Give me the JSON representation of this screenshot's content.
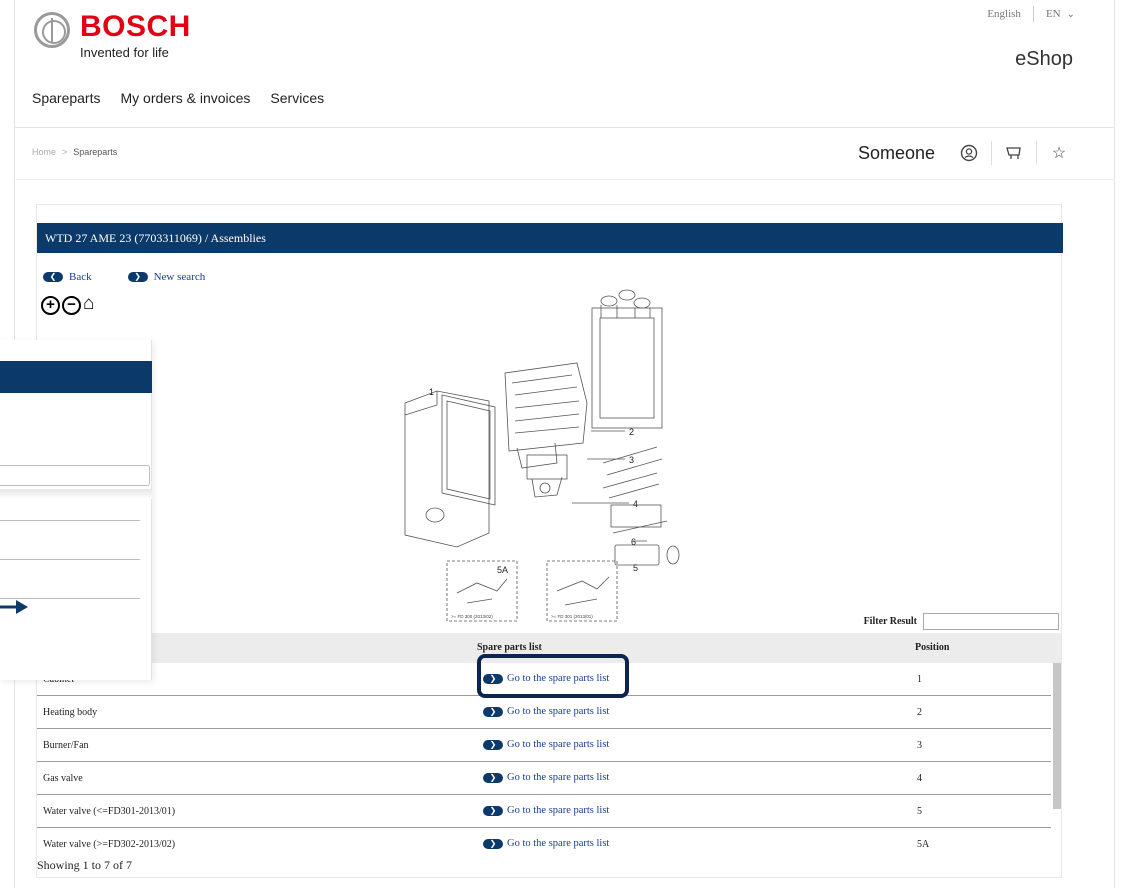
{
  "header": {
    "brand": "BOSCH",
    "tagline": "Invented for life",
    "language": "English",
    "language_code": "EN",
    "shop_title": "eShop"
  },
  "nav": {
    "items": [
      "Spareparts",
      "My orders & invoices",
      "Services"
    ]
  },
  "breadcrumb": {
    "home": "Home",
    "separator": ">",
    "current": "Spareparts"
  },
  "account": {
    "user_name": "Someone",
    "icons": [
      "user-circle-icon",
      "cart-icon",
      "star-icon"
    ]
  },
  "panel": {
    "title": "WTD 27 AME 23 (7703311069) / Assemblies",
    "back_label": "Back",
    "new_search_label": "New search"
  },
  "diagram": {
    "callouts": [
      "1",
      "2",
      "3",
      "4",
      "5",
      "5A",
      "6"
    ],
    "caption_a": ">= FD 300 (2013/02)",
    "caption_b": ">= FD 301 (2013/01)"
  },
  "filter": {
    "label": "Filter Result",
    "value": ""
  },
  "table": {
    "headers": [
      "Spare parts list",
      "Position"
    ],
    "link_label": "Go to the spare parts list",
    "rows": [
      {
        "name": "Cabinet",
        "position": "1"
      },
      {
        "name": "Heating body",
        "position": "2"
      },
      {
        "name": "Burner/Fan",
        "position": "3"
      },
      {
        "name": "Gas valve",
        "position": "4"
      },
      {
        "name": "Water valve (<=FD301-2013/01)",
        "position": "5"
      },
      {
        "name": "Water valve (>=FD302-2013/02)",
        "position": "5A"
      }
    ],
    "showing": "Showing 1 to 7 of 7"
  },
  "colors": {
    "brand_red": "#e20015",
    "header_blue": "#0b3a6a",
    "link_blue": "#1a3d8f"
  }
}
